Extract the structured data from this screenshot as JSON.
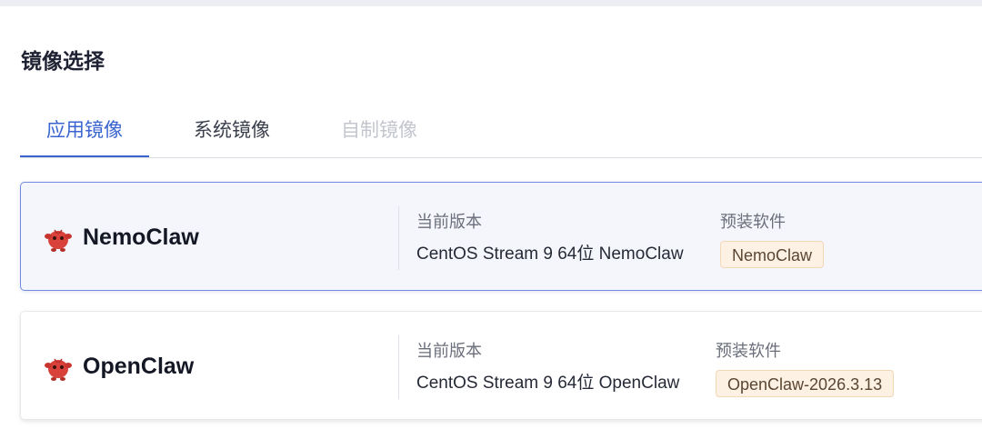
{
  "section": {
    "title": "镜像选择"
  },
  "tabs": [
    {
      "label": "应用镜像",
      "state": "active"
    },
    {
      "label": "系统镜像",
      "state": "normal"
    },
    {
      "label": "自制镜像",
      "state": "disabled"
    }
  ],
  "cards": [
    {
      "name": "NemoClaw",
      "icon": "red-creature-icon",
      "selected": true,
      "version_label": "当前版本",
      "version_value": "CentOS Stream 9 64位 NemoClaw",
      "software_label": "预装软件",
      "software_tag": "NemoClaw"
    },
    {
      "name": "OpenClaw",
      "icon": "red-creature-icon",
      "selected": false,
      "version_label": "当前版本",
      "version_value": "CentOS Stream 9 64位 OpenClaw",
      "software_label": "预装软件",
      "software_tag": "OpenClaw-2026.3.13"
    }
  ],
  "colors": {
    "accent": "#3a64d0",
    "icon_red": "#d9423a",
    "tag_bg": "#fdf1e3"
  }
}
